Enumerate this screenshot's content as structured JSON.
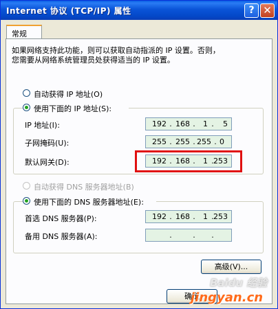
{
  "window": {
    "title": "Internet 协议 (TCP/IP) 属性",
    "help_glyph": "?",
    "close_glyph": "✕"
  },
  "tabs": [
    {
      "label": "常规",
      "selected": true
    }
  ],
  "description": {
    "line1": "如果网络支持此功能，则可以获取自动指派的 IP 设置。否则，",
    "line2": "您需要从网络系统管理员处获得适当的 IP 设置。"
  },
  "ip_mode": {
    "auto_label": "自动获得 IP 地址(O)",
    "manual_label": "使用下面的 IP 地址(S):",
    "selected": "manual"
  },
  "ip_fields": [
    {
      "label": "IP 地址(I):",
      "octets": [
        "192",
        "168",
        "1",
        "5"
      ]
    },
    {
      "label": "子网掩码(U):",
      "octets": [
        "255",
        "255",
        "255",
        "0"
      ]
    },
    {
      "label": "默认网关(D):",
      "octets": [
        "192",
        "168",
        "1",
        "253"
      ]
    }
  ],
  "dns_mode": {
    "auto_label": "自动获得 DNS 服务器地址(B)",
    "auto_enabled": false,
    "manual_label": "使用下面的 DNS 服务器地址(E):",
    "selected": "manual"
  },
  "dns_fields": [
    {
      "label": "首选 DNS 服务器(P):",
      "octets": [
        "192",
        "168",
        "1",
        "253"
      ]
    },
    {
      "label": "备用 DNS 服务器(A):",
      "octets": [
        "",
        "",
        "",
        ""
      ]
    }
  ],
  "advanced_button": "高级(V)...",
  "ok_button": "确定",
  "watermark": {
    "brand": "Baidu 经验",
    "site": "jingyan.cn"
  },
  "colors": {
    "highlight": "#e01010",
    "title_bar": "#0a54d8",
    "field_bg": "#e4f3e4"
  }
}
